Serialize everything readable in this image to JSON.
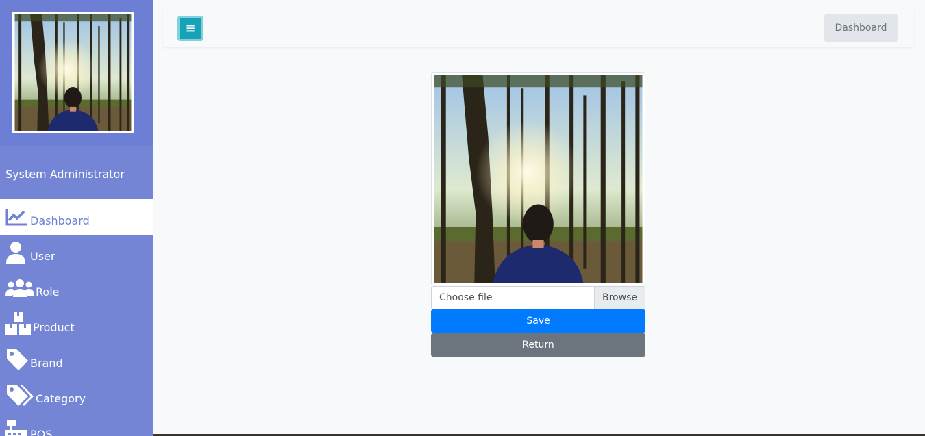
{
  "sidebar": {
    "user_name": "System Administrator",
    "items": [
      {
        "label": "Dashboard",
        "icon": "chart-line-icon",
        "active": true
      },
      {
        "label": "User",
        "icon": "user-icon"
      },
      {
        "label": "Role",
        "icon": "users-icon"
      },
      {
        "label": "Product",
        "icon": "boxes-icon"
      },
      {
        "label": "Brand",
        "icon": "tag-icon"
      },
      {
        "label": "Category",
        "icon": "tags-icon"
      },
      {
        "label": "POS",
        "icon": "cash-register-icon"
      }
    ]
  },
  "topbar": {
    "toggle_icon": "menu-icon",
    "dashboard_label": "Dashboard"
  },
  "form": {
    "file_placeholder": "Choose file",
    "browse_label": "Browse",
    "save_label": "Save",
    "return_label": "Return"
  },
  "colors": {
    "sidebar": "#7585d6",
    "toggle": "#17a2b8",
    "save": "#007bff",
    "return": "#6c757d"
  }
}
